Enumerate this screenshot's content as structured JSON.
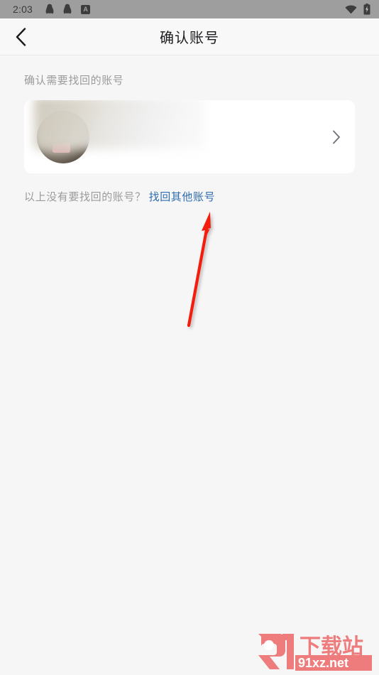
{
  "status_bar": {
    "time": "2:03",
    "icons": [
      "qq-icon",
      "qq-icon",
      "a-badge-icon"
    ],
    "a_badge_label": "A",
    "right_icons": [
      "wifi-icon",
      "battery-charging-icon"
    ],
    "background_color": "#9e9e9e"
  },
  "header": {
    "back_icon": "chevron-left-icon",
    "title": "确认账号"
  },
  "main": {
    "section_label": "确认需要找回的账号",
    "account_card": {
      "avatar": "user-avatar-blurred",
      "name": "",
      "chevron_icon": "chevron-right-icon"
    },
    "recover_prompt": "以上没有要找回的账号？",
    "recover_link": "找回其他账号",
    "link_color": "#2e6cb0"
  },
  "annotation": {
    "arrow": "red-arrow-up-right",
    "color": "#f41b09"
  },
  "watermark": {
    "logo_text": "91",
    "site_name": "下载站",
    "domain": "91xz.net",
    "color": "#ee7c7c"
  }
}
